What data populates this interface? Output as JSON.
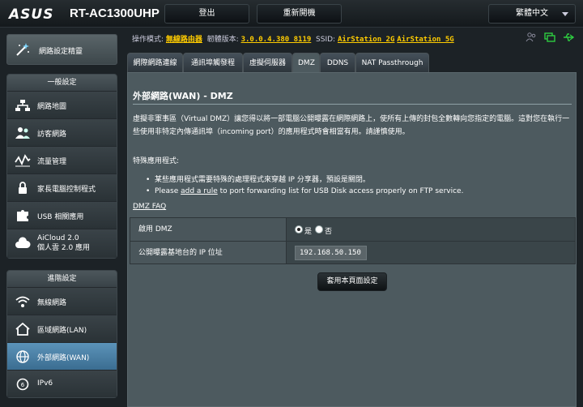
{
  "header": {
    "logo": "ASUS",
    "model": "RT-AC1300UHP",
    "logout_label": "登出",
    "reboot_label": "重新開機",
    "language": "繁體中文"
  },
  "sidebar": {
    "wizard_label": "網路設定精靈",
    "general_header": "一般設定",
    "general_items": [
      {
        "label": "網路地圖"
      },
      {
        "label": "訪客網路"
      },
      {
        "label": "流量管理"
      },
      {
        "label": "家長電腦控制程式"
      },
      {
        "label": "USB 相關應用"
      },
      {
        "label": "AiCloud 2.0",
        "label2": "個人雲 2.0 應用"
      }
    ],
    "advanced_header": "進階設定",
    "advanced_items": [
      {
        "label": "無線網路"
      },
      {
        "label": "區域網路(LAN)"
      },
      {
        "label": "外部網路(WAN)"
      },
      {
        "label": "IPv6"
      }
    ]
  },
  "status": {
    "mode_label": "操作模式:",
    "mode_value": "無線路由器",
    "firmware_label": "韌體版本:",
    "firmware_value": "3.0.0.4.380_8119",
    "ssid_label": "SSID:",
    "ssid_1": "AirStation_2G",
    "ssid_2": "AirStation_5G"
  },
  "tabs": [
    {
      "label": "網際網路連線"
    },
    {
      "label": "通訊埠觸發程式"
    },
    {
      "label": "虛擬伺服器"
    },
    {
      "label": "DMZ"
    },
    {
      "label": "DDNS"
    },
    {
      "label": "NAT Passthrough"
    }
  ],
  "main": {
    "title": "外部網路(WAN) - DMZ",
    "description": "虛擬非軍事區（Virtual DMZ）讓您得以將一部電腦公開曝露在網際網路上，使所有上傳的封包全數轉向您指定的電腦。這對您在執行一些使用非特定內傳通訊埠（incoming port）的應用程式時會相當有用。請謹慎使用。",
    "special_label": "特殊應用程式:",
    "bullet1": "某些應用程式需要特殊的處理程式來穿越 IP 分享器，預設是關閉。",
    "bullet2_pre": "Please ",
    "bullet2_link": "add a rule",
    "bullet2_post": " to port forwarding list for USB Disk access properly on FTP service.",
    "faq_link": "DMZ  FAQ",
    "enable_label": "啟用 DMZ",
    "yes_label": "是",
    "no_label": "否",
    "enabled": true,
    "ip_label": "公開曝露基地台的 IP 位址",
    "ip_value": "192.168.50.150",
    "apply_label": "套用本頁面設定"
  }
}
